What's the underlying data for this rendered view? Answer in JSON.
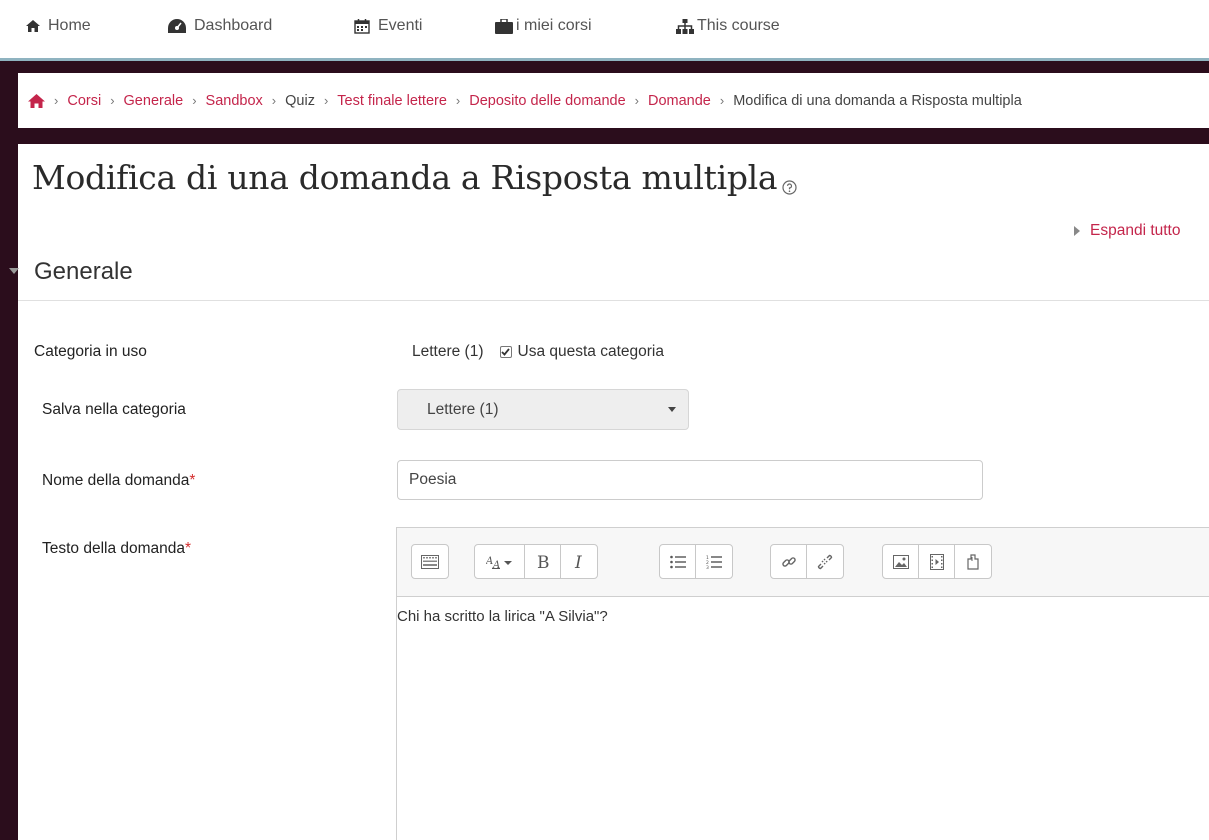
{
  "topnav": {
    "items": [
      {
        "label": "Home",
        "icon": "home-icon"
      },
      {
        "label": "Dashboard",
        "icon": "dashboard-icon"
      },
      {
        "label": "Eventi",
        "icon": "calendar-icon"
      },
      {
        "label": "i miei corsi",
        "icon": "briefcase-icon"
      },
      {
        "label": "This course",
        "icon": "sitemap-icon"
      }
    ]
  },
  "breadcrumb": {
    "items": [
      "Corsi",
      "Generale",
      "Sandbox",
      "Quiz",
      "Test finale lettere",
      "Deposito delle domande",
      "Domande"
    ],
    "current": "Modifica di una domanda a Risposta multipla"
  },
  "page": {
    "title": "Modifica di una domanda a Risposta multipla",
    "expand_all": "Espandi tutto"
  },
  "section": {
    "title": "Generale"
  },
  "form": {
    "current_category_label": "Categoria in uso",
    "current_category_value": "Lettere (1)",
    "use_category_label": "Usa questa categoria",
    "use_category_checked": true,
    "save_category_label": "Salva nella categoria",
    "save_category_value": "Lettere (1)",
    "question_name_label": "Nome della domanda",
    "question_name_value": "Poesia",
    "question_text_label": "Testo della domanda",
    "question_text_value": "Chi ha scritto la lirica \"A Silvia\"?",
    "required_marker": "*"
  },
  "colors": {
    "accent": "#c4254b",
    "frame": "#2b0d1c",
    "nav_border": "#8fb3c0"
  }
}
